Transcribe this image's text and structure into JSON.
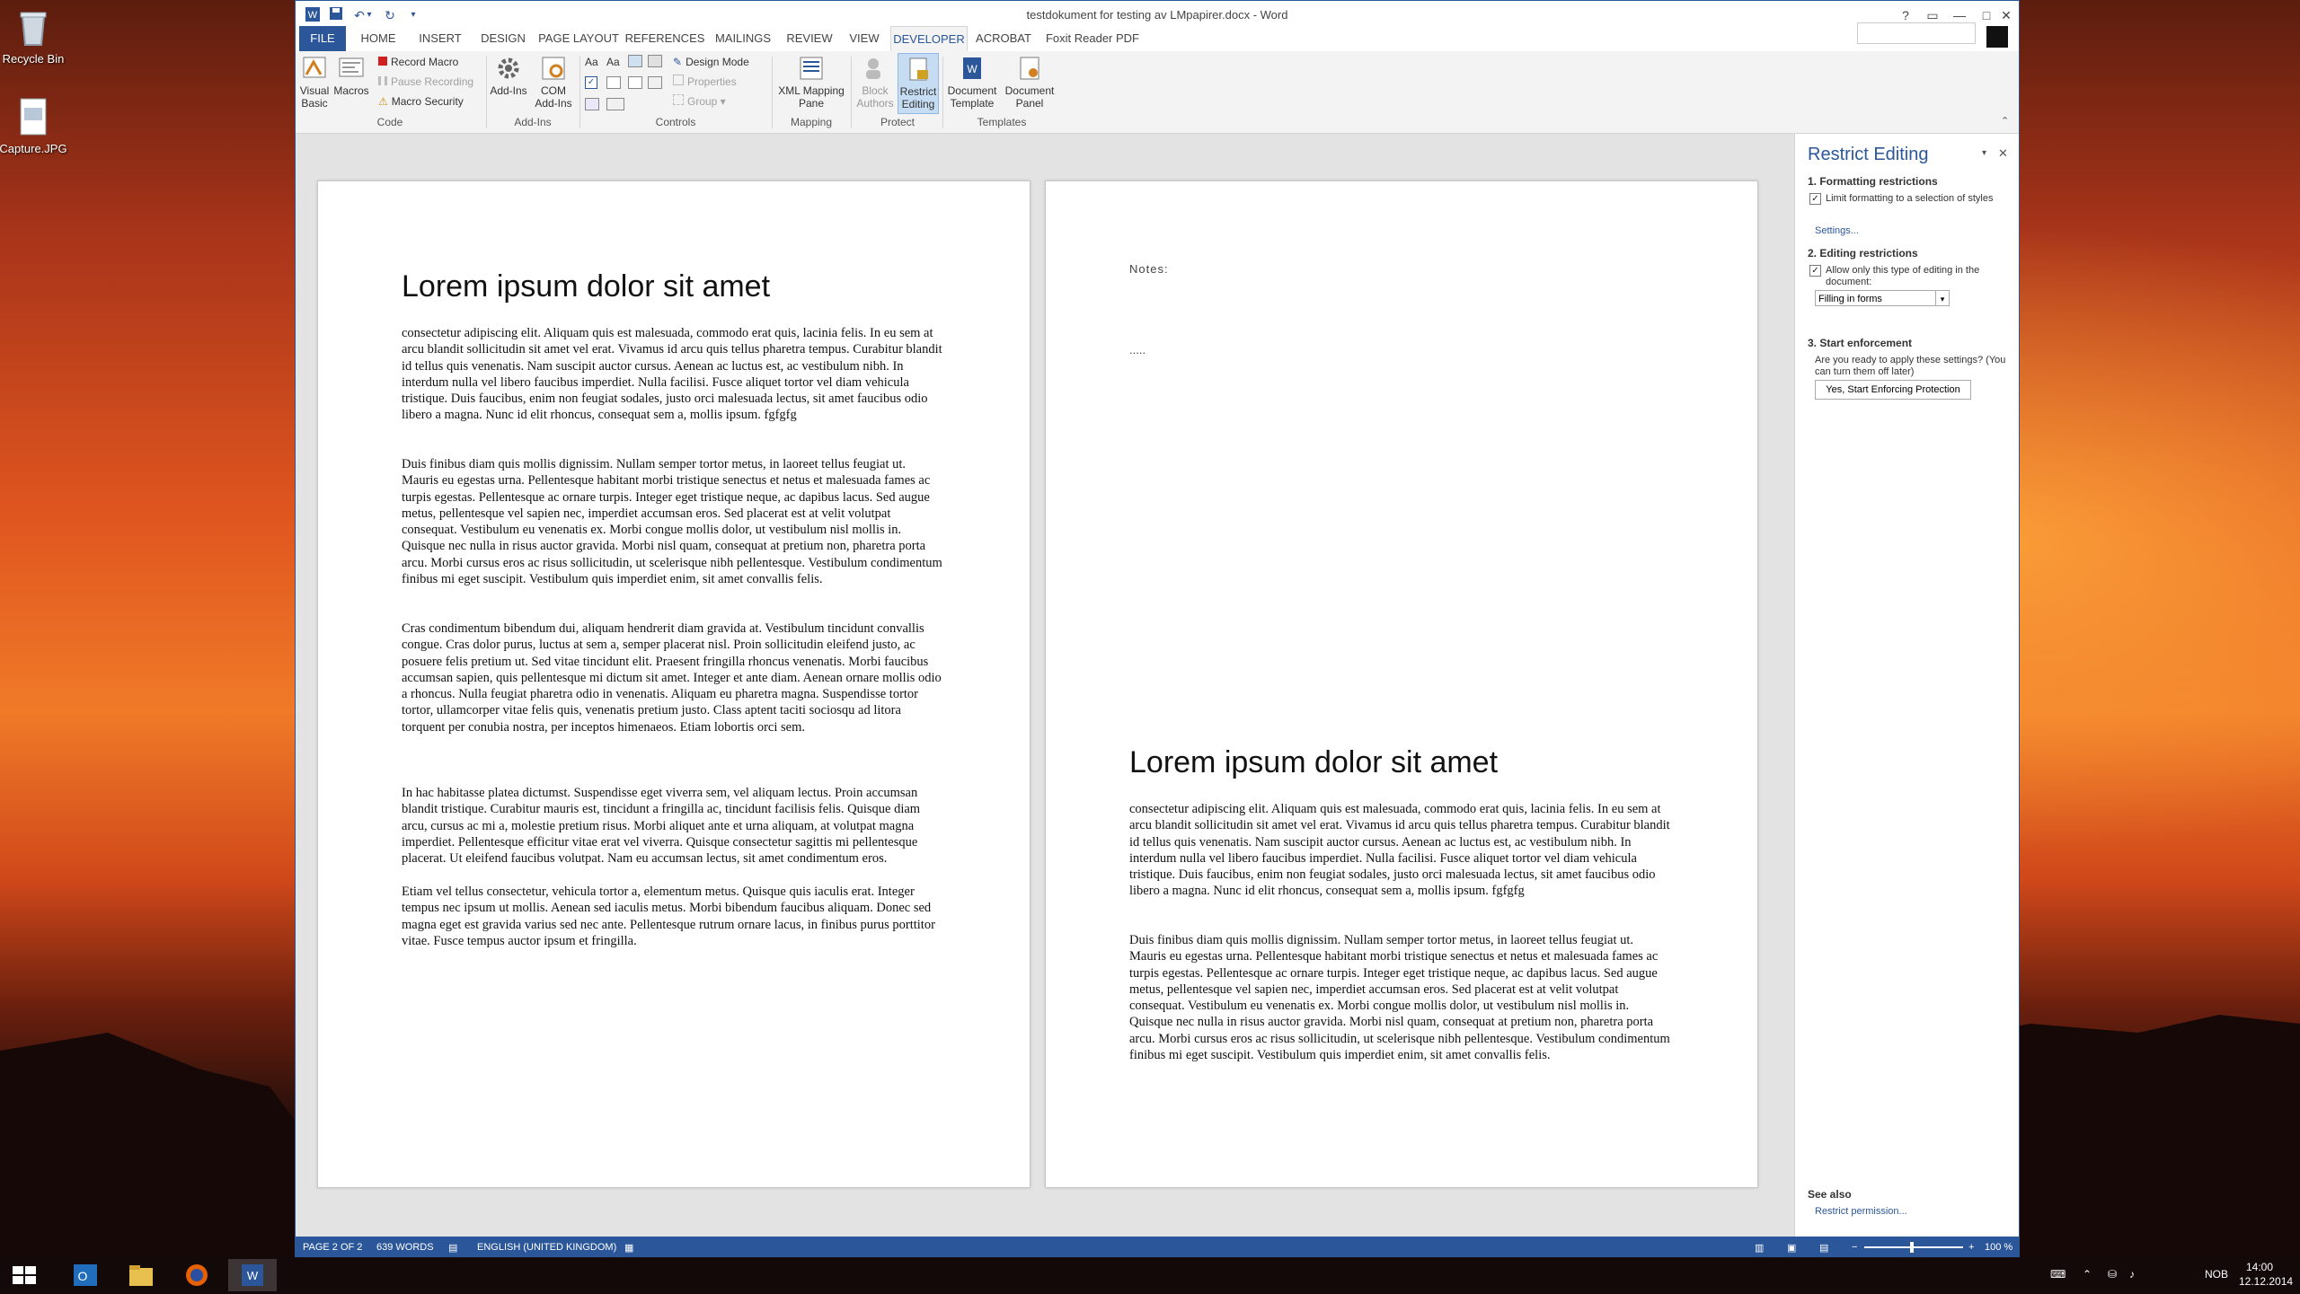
{
  "desktop": {
    "icons": [
      {
        "label": "Recycle Bin"
      },
      {
        "label": "Capture.JPG"
      }
    ]
  },
  "window": {
    "title": "testdokument for testing av LMpapirer.docx - Word",
    "controls": {
      "help": "?",
      "restore_ribbon": "▭",
      "minimize": "—",
      "maximize": "□",
      "close": "✕"
    }
  },
  "qat": {
    "save": "💾",
    "undo": "↶",
    "redo": "↻",
    "customize": "▾"
  },
  "tabs": [
    "FILE",
    "HOME",
    "INSERT",
    "DESIGN",
    "PAGE LAYOUT",
    "REFERENCES",
    "MAILINGS",
    "REVIEW",
    "VIEW",
    "DEVELOPER",
    "ACROBAT",
    "Foxit Reader PDF"
  ],
  "ribbon": {
    "code": {
      "label": "Code",
      "visual_basic": "Visual Basic",
      "macros": "Macros",
      "record_macro": "Record Macro",
      "pause_recording": "Pause Recording",
      "macro_security": "Macro Security"
    },
    "addins": {
      "label": "Add-Ins",
      "addins": "Add-Ins",
      "com_addins": "COM Add-Ins"
    },
    "controls": {
      "label": "Controls",
      "design_mode": "Design Mode",
      "properties": "Properties",
      "group": "Group ▾"
    },
    "mapping": {
      "label": "Mapping",
      "xml_mapping_pane": "XML Mapping Pane"
    },
    "protect": {
      "label": "Protect",
      "block_authors": "Block Authors",
      "restrict_editing": "Restrict Editing"
    },
    "templates": {
      "label": "Templates",
      "document_template": "Document Template",
      "document_panel": "Document Panel"
    }
  },
  "document": {
    "heading": "Lorem ipsum dolor sit amet",
    "notes_label": "Notes:",
    "notes_dots": ".....",
    "paragraphs": [
      "consectetur adipiscing elit. Aliquam quis est malesuada, commodo erat quis, lacinia felis. In eu sem at arcu blandit sollicitudin sit amet vel erat. Vivamus id arcu quis tellus pharetra tempus. Curabitur blandit id tellus quis venenatis. Nam suscipit auctor cursus. Aenean ac luctus est, ac vestibulum nibh. In interdum nulla vel libero faucibus imperdiet. Nulla facilisi. Fusce aliquet tortor vel diam vehicula tristique. Duis faucibus, enim non feugiat sodales, justo orci malesuada lectus, sit amet faucibus odio libero a magna. Nunc id elit rhoncus, consequat sem a, mollis ipsum. fgfgfg",
      "Duis finibus diam quis mollis dignissim. Nullam semper tortor metus, in laoreet tellus feugiat ut. Mauris eu egestas urna. Pellentesque habitant morbi tristique senectus et netus et malesuada fames ac turpis egestas. Pellentesque ac ornare turpis. Integer eget tristique neque, ac dapibus lacus. Sed augue metus, pellentesque vel sapien nec, imperdiet accumsan eros. Sed placerat est at velit volutpat consequat. Vestibulum eu venenatis ex. Morbi congue mollis dolor, ut vestibulum nisl mollis in. Quisque nec nulla in risus auctor gravida. Morbi nisl quam, consequat at pretium non, pharetra porta arcu. Morbi cursus eros ac risus sollicitudin, ut scelerisque nibh pellentesque. Vestibulum condimentum finibus mi eget suscipit. Vestibulum quis imperdiet enim, sit amet convallis felis.",
      "Cras condimentum bibendum dui, aliquam hendrerit diam gravida at. Vestibulum tincidunt convallis congue. Cras dolor purus, luctus at sem a, semper placerat nisl. Proin sollicitudin eleifend justo, ac posuere felis pretium ut. Sed vitae tincidunt elit. Praesent fringilla rhoncus venenatis. Morbi faucibus accumsan sapien, quis pellentesque mi dictum sit amet. Integer et ante diam. Aenean ornare mollis odio a rhoncus. Nulla feugiat pharetra odio in venenatis. Aliquam eu pharetra magna. Suspendisse tortor tortor, ullamcorper vitae felis quis, venenatis pretium justo. Class aptent taciti sociosqu ad litora torquent per conubia nostra, per inceptos himenaeos. Etiam lobortis orci sem.",
      "In hac habitasse platea dictumst. Suspendisse eget viverra sem, vel aliquam lectus. Proin accumsan blandit tristique. Curabitur mauris est, tincidunt a fringilla ac, tincidunt facilisis felis. Quisque diam arcu, cursus ac mi a, molestie pretium risus. Morbi aliquet ante et urna aliquam, at volutpat magna imperdiet. Pellentesque efficitur vitae erat vel viverra. Quisque consectetur sagittis mi pellentesque placerat. Ut eleifend faucibus volutpat. Nam eu accumsan lectus, sit amet condimentum eros.",
      "Etiam vel tellus consectetur, vehicula tortor a, elementum metus. Quisque quis iaculis erat. Integer tempus nec ipsum ut mollis. Aenean sed iaculis metus. Morbi bibendum faucibus aliquam. Donec sed magna eget est gravida varius sed nec ante. Pellentesque rutrum ornare lacus, in finibus purus porttitor vitae. Fusce tempus auctor ipsum et fringilla."
    ]
  },
  "restrict_pane": {
    "title": "Restrict Editing",
    "section1": "1. Formatting restrictions",
    "limit_formatting": "Limit formatting to a selection of styles",
    "settings_link": "Settings...",
    "section2": "2. Editing restrictions",
    "allow_only": "Allow only this type of editing in the document:",
    "editing_type": "Filling in forms",
    "section3": "3. Start enforcement",
    "ready_q": "Are you ready to apply these settings? (You can turn them off later)",
    "start_button": "Yes, Start Enforcing Protection",
    "see_also": "See also",
    "restrict_permission": "Restrict permission..."
  },
  "statusbar": {
    "page": "PAGE 2 OF 2",
    "words": "639 WORDS",
    "language": "ENGLISH (UNITED KINGDOM)",
    "zoom": "100 %"
  },
  "taskbar": {
    "time": "14:00",
    "date": "12.12.2014",
    "lang": "NOB"
  },
  "colors": {
    "word_blue": "#2b579a",
    "spell_red": "#e02020"
  }
}
